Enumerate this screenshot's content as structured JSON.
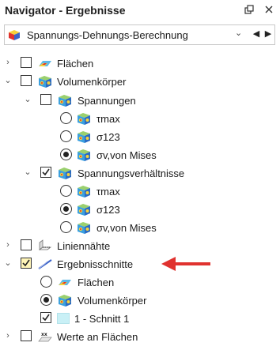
{
  "window": {
    "title": "Navigator - Ergebnisse",
    "pin_icon": "pin-icon",
    "close_icon": "close-icon"
  },
  "combo": {
    "value": "Spannungs-Dehnungs-Berechnung",
    "dropdown_icon": "chevron-down-icon",
    "prev_icon": "triangle-left-icon",
    "next_icon": "triangle-right-icon"
  },
  "tree": {
    "flaechen": "Flächen",
    "volumenkoerper": "Volumenkörper",
    "spannungen": "Spannungen",
    "tau_max": "τmax",
    "sigma123": "σ123",
    "sigma_vm": "σv,von Mises",
    "spannungsverhaeltnisse": "Spannungsverhältnisse",
    "tau_max_2": "τmax",
    "sigma123_2": "σ123",
    "sigma_vm_2": "σv,von Mises",
    "liniennaehte": "Liniennähte",
    "ergebnisschnitte": "Ergebnisschnitte",
    "es_flaechen": "Flächen",
    "es_volumenkoerper": "Volumenkörper",
    "schnitt1": "1 - Schnitt 1",
    "werte_an_flaechen": "Werte an Flächen"
  },
  "annotation": {
    "arrow_color": "#e0322f"
  }
}
